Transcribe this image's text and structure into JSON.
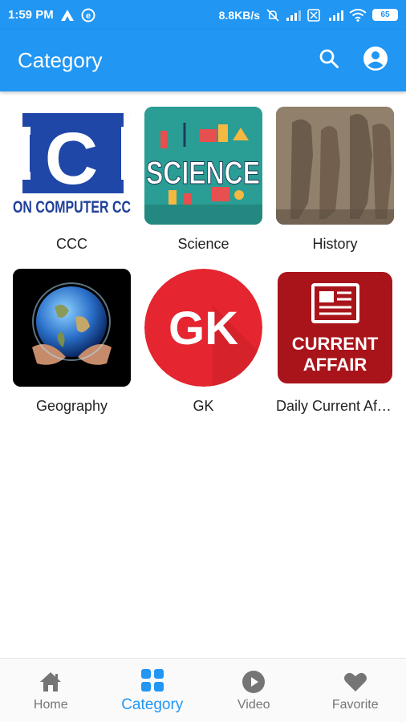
{
  "status_bar": {
    "time": "1:59 PM",
    "network_speed": "8.8KB/s",
    "battery": "65"
  },
  "app_bar": {
    "title": "Category",
    "search_icon": "search-icon",
    "account_icon": "account-icon"
  },
  "categories": [
    {
      "label": "CCC",
      "image_text": [
        "C",
        "ON COMPUTER CC"
      ]
    },
    {
      "label": "Science",
      "image_text": [
        "SCIENCE"
      ]
    },
    {
      "label": "History"
    },
    {
      "label": "Geography"
    },
    {
      "label": "GK",
      "image_text": [
        "GK"
      ]
    },
    {
      "label": "Daily Current Affairs",
      "image_text": [
        "CURRENT",
        "AFFAIR"
      ]
    }
  ],
  "bottom_nav": {
    "items": [
      {
        "label": "Home",
        "icon": "home-icon"
      },
      {
        "label": "Category",
        "icon": "grid-icon"
      },
      {
        "label": "Video",
        "icon": "play-circle-icon"
      },
      {
        "label": "Favorite",
        "icon": "heart-icon"
      }
    ],
    "active": "Category"
  },
  "colors": {
    "primary": "#2196F3",
    "active_nav": "#2196F3",
    "inactive_nav": "#757575"
  }
}
